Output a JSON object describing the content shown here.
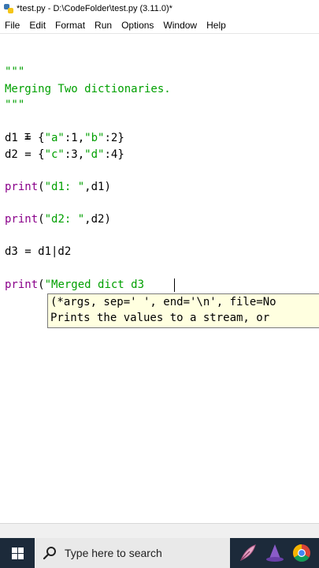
{
  "window": {
    "title": "*test.py - D:\\CodeFolder\\test.py (3.11.0)*"
  },
  "menu": [
    "File",
    "Edit",
    "Format",
    "Run",
    "Options",
    "Window",
    "Help"
  ],
  "code": {
    "l1": "\"\"\"",
    "l2": "Merging Two dictionaries.",
    "l3": "\"\"\"",
    "l4_a": "d1 = {",
    "l4_b": "\"a\"",
    "l4_c": ":1,",
    "l4_d": "\"b\"",
    "l4_e": ":2}",
    "l5_a": "d2 = {",
    "l5_b": "\"c\"",
    "l5_c": ":3,",
    "l5_d": "\"d\"",
    "l5_e": ":4}",
    "l6_a": "print",
    "l6_b": "(",
    "l6_c": "\"d1: \"",
    "l6_d": ",d1)",
    "l7_a": "print",
    "l7_b": "(",
    "l7_c": "\"d2: \"",
    "l7_d": ",d2)",
    "l8": "d3 = d1|d2",
    "l9_a": "print",
    "l9_b": "(",
    "l9_c": "\"Merged dict d3"
  },
  "calltip": {
    "signature": "(*args, sep=' ', end='\\n', file=No",
    "doc": "Prints the values to a stream, or"
  },
  "taskbar": {
    "search_placeholder": "Type here to search"
  }
}
